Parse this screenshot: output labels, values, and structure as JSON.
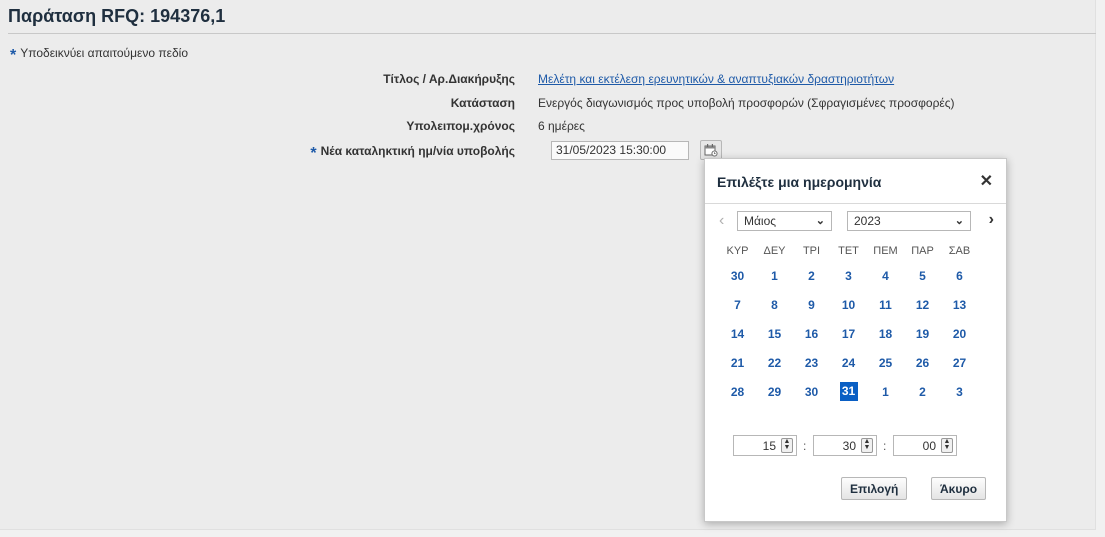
{
  "page": {
    "title": "Παράταση RFQ: 194376,1",
    "required_note": "Υποδεικνύει απαιτούμενο πεδίο"
  },
  "form": {
    "title_label": "Τίτλος / Αρ.Διακήρυξης",
    "title_value": "Μελέτη και εκτέλεση ερευνητικών & αναπτυξιακών δραστηριοτήτων",
    "status_label": "Κατάσταση",
    "status_value": "Ενεργός διαγωνισμός προς υποβολή προσφορών (Σφραγισμένες προσφορές)",
    "remaining_label": "Υπολειπομ.χρόνος",
    "remaining_value": "6 ημέρες",
    "deadline_label": "Νέα καταληκτική ημ/νία υποβολής",
    "deadline_value": "31/05/2023 15:30:00"
  },
  "datepicker": {
    "title": "Επιλέξτε μια ημερομηνία",
    "month": "Μάιος",
    "year": "2023",
    "weekdays": [
      "ΚΥΡ",
      "ΔΕΥ",
      "ΤΡΙ",
      "ΤΕΤ",
      "ΠΕΜ",
      "ΠΑΡ",
      "ΣΑΒ"
    ],
    "weeks": [
      [
        "30",
        "1",
        "2",
        "3",
        "4",
        "5",
        "6"
      ],
      [
        "7",
        "8",
        "9",
        "10",
        "11",
        "12",
        "13"
      ],
      [
        "14",
        "15",
        "16",
        "17",
        "18",
        "19",
        "20"
      ],
      [
        "21",
        "22",
        "23",
        "24",
        "25",
        "26",
        "27"
      ],
      [
        "28",
        "29",
        "30",
        "31",
        "1",
        "2",
        "3"
      ]
    ],
    "selected_day": "31",
    "hour": "15",
    "minute": "30",
    "second": "00",
    "ok_label": "Επιλογή",
    "cancel_label": "Άκυρο"
  },
  "icons": {
    "required": "asterisk-icon",
    "calendar": "calendar-icon",
    "close": "close-icon",
    "prev": "chevron-left-icon",
    "next": "chevron-right-icon"
  },
  "colors": {
    "link": "#1e5aa8",
    "selected_day": "#0a5fc4",
    "title": "#1f2f3f"
  }
}
